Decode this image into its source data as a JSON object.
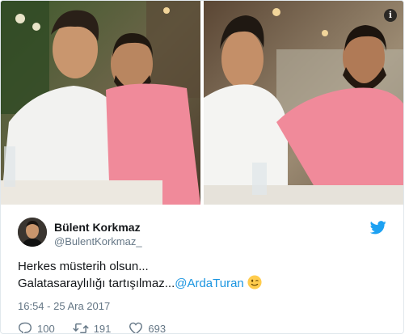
{
  "author": {
    "display_name": "Bülent Korkmaz",
    "handle": "@BulentKorkmaz_"
  },
  "tweet": {
    "line1": "Herkes müsterih olsun...",
    "line2_prefix": "Galatasaraylılığı tartışılmaz...",
    "mention": "@ArdaTuran",
    "emoji": "winking-face-emoji",
    "timestamp": "16:54 - 25 Ara 2017"
  },
  "stats": {
    "replies": "100",
    "retweets": "191",
    "likes": "693"
  },
  "icons": {
    "info": "i",
    "twitter_bird": "twitter-bird-icon"
  },
  "colors": {
    "brand": "#1da1f2",
    "link": "#1b95e0",
    "muted": "#657786",
    "text": "#14171a"
  }
}
